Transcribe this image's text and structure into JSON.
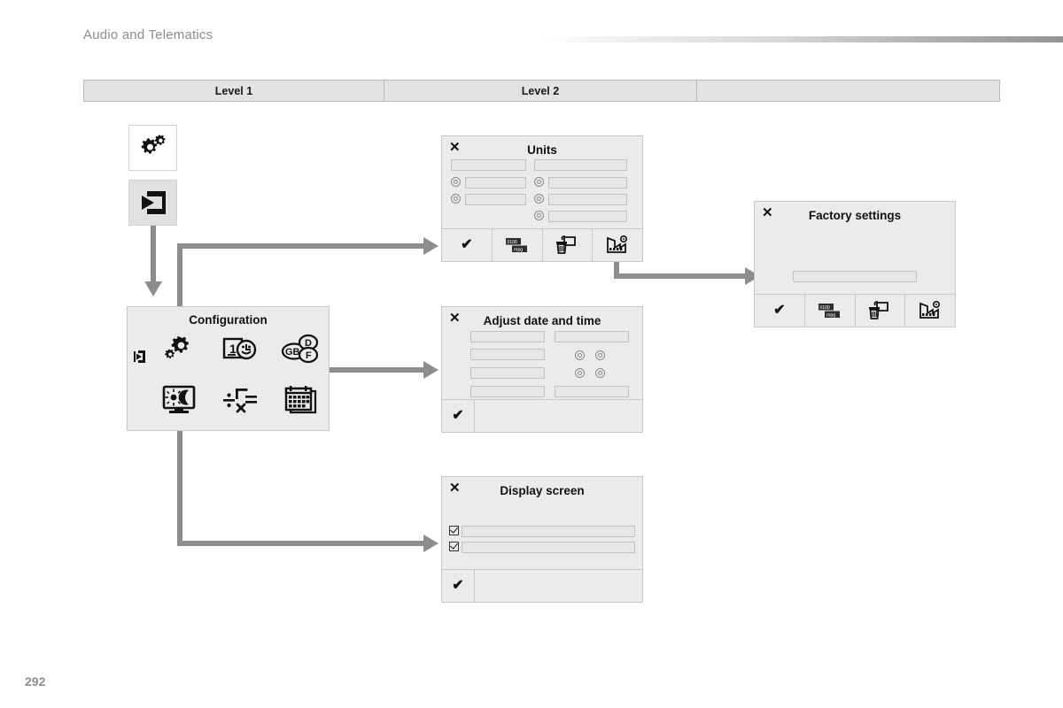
{
  "document": {
    "header_title": "Audio and Telematics",
    "page_number": "292"
  },
  "level_table": {
    "columns": [
      "Level 1",
      "Level 2",
      ""
    ]
  },
  "menu_tiles": [
    {
      "icon": "gears-icon",
      "name": "settings-gears-tile"
    },
    {
      "icon": "enter-arrow-box-icon",
      "name": "menu-enter-tile"
    }
  ],
  "config_menu": {
    "title": "Configuration",
    "back_icon": "exit-arrow-icon",
    "icons": [
      {
        "name": "gears-icon",
        "label": "gears-icon"
      },
      {
        "name": "date-time-icon",
        "label": "date-time-icon"
      },
      {
        "name": "language-gb-d-f-icon",
        "label": "language-gb-d-f-icon"
      },
      {
        "name": "display-brightness-icon",
        "label": "display-brightness-icon"
      },
      {
        "name": "units-math-icon",
        "label": "units-math-icon"
      },
      {
        "name": "calendar-icon",
        "label": "calendar-icon"
      }
    ]
  },
  "screens": {
    "units": {
      "title": "Units",
      "close_icon": "close-icon",
      "footer": [
        {
          "icon": "check-icon",
          "label": "✔"
        },
        {
          "icon": "units-l100-mpg-icon",
          "label": "l/100 mpg"
        },
        {
          "icon": "delete-trash-icon",
          "label": "delete"
        },
        {
          "icon": "factory-settings-icon",
          "label": "factory"
        }
      ]
    },
    "factory_settings": {
      "title": "Factory settings",
      "close_icon": "close-icon",
      "footer": [
        {
          "icon": "check-icon",
          "label": "✔"
        },
        {
          "icon": "units-l100-mpg-icon",
          "label": "l/100 mpg"
        },
        {
          "icon": "delete-trash-icon",
          "label": "delete"
        },
        {
          "icon": "factory-settings-icon",
          "label": "factory"
        }
      ]
    },
    "adjust_date_time": {
      "title": "Adjust date and time",
      "close_icon": "close-icon",
      "footer": [
        {
          "icon": "check-icon",
          "label": "✔"
        }
      ]
    },
    "display_screen": {
      "title": "Display screen",
      "close_icon": "close-icon",
      "footer": [
        {
          "icon": "check-icon",
          "label": "✔"
        }
      ]
    }
  }
}
